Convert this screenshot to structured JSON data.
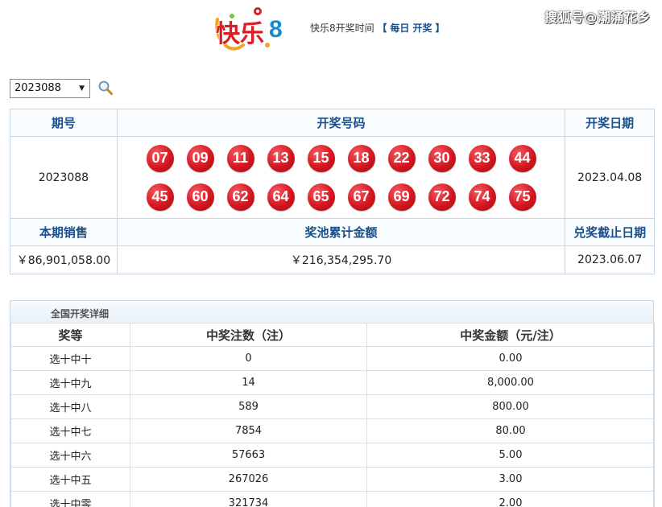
{
  "header": {
    "draw_time_label": "快乐8开奖时间",
    "bracket_open": "【",
    "draw_time_value": "每日 开奖",
    "bracket_close": "】",
    "watermark": "搜狐号@潮涌花乡"
  },
  "search": {
    "selected_issue": "2023088",
    "search_icon": "magnifier-icon"
  },
  "result": {
    "col_issue": "期号",
    "col_numbers": "开奖号码",
    "col_date": "开奖日期",
    "issue": "2023088",
    "date": "2023.04.08",
    "numbers": [
      "07",
      "09",
      "11",
      "13",
      "15",
      "18",
      "22",
      "30",
      "33",
      "44",
      "45",
      "60",
      "62",
      "64",
      "65",
      "67",
      "69",
      "72",
      "74",
      "75"
    ],
    "col_sales": "本期销售",
    "col_pool": "奖池累计金额",
    "col_deadline": "兑奖截止日期",
    "sales": "￥86,901,058.00",
    "pool": "￥216,354,295.70",
    "deadline": "2023.06.07"
  },
  "detail": {
    "caption": "全国开奖详细",
    "headers": [
      "奖等",
      "中奖注数（注）",
      "中奖金额（元/注）"
    ],
    "rows": [
      [
        "选十中十",
        "0",
        "0.00"
      ],
      [
        "选十中九",
        "14",
        "8,000.00"
      ],
      [
        "选十中八",
        "589",
        "800.00"
      ],
      [
        "选十中七",
        "7854",
        "80.00"
      ],
      [
        "选十中六",
        "57663",
        "5.00"
      ],
      [
        "选十中五",
        "267026",
        "3.00"
      ],
      [
        "选十中零",
        "321734",
        "2.00"
      ]
    ]
  },
  "colors": {
    "ball_red": "#d4161f",
    "header_blue": "#1a4f8b",
    "border_blue": "#c7d7e6"
  }
}
